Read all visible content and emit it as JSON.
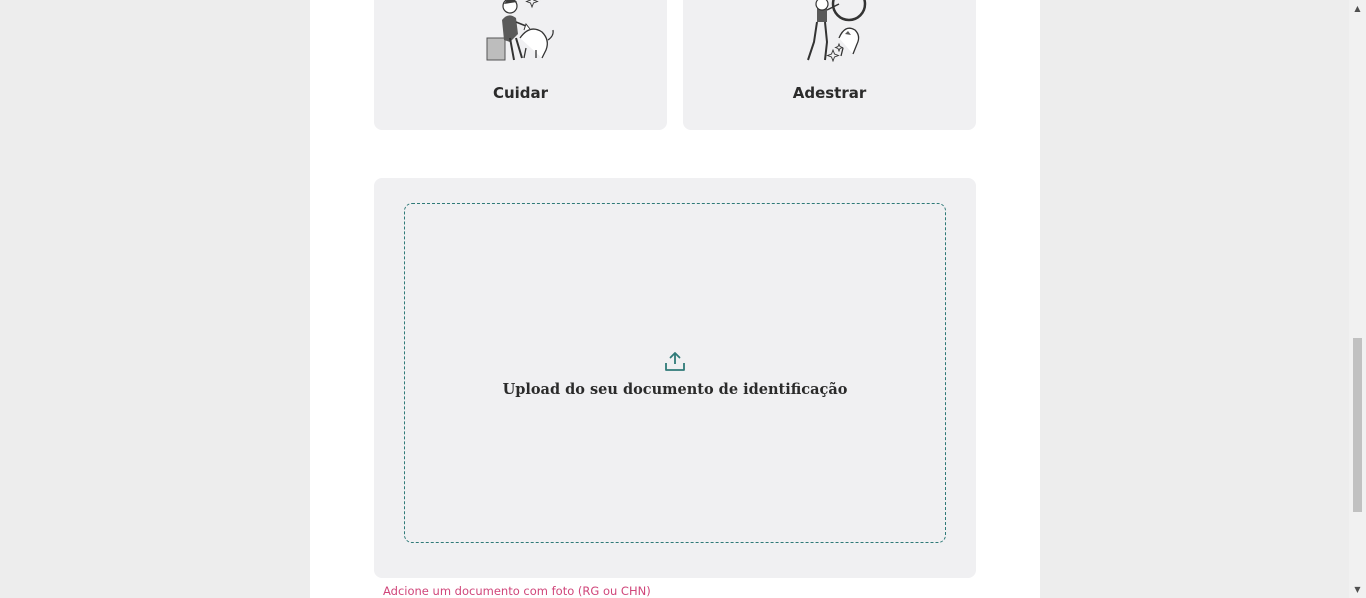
{
  "cards": [
    {
      "label": "Cuidar",
      "icon": "person-petting-dog-illustration"
    },
    {
      "label": "Adestrar",
      "icon": "person-training-dog-illustration"
    }
  ],
  "upload": {
    "label": "Upload do seu documento de identificação",
    "icon": "upload-icon",
    "accent_color": "#2f7a78"
  },
  "hint": {
    "text": "Adcione um documento com foto (RG ou CHN)",
    "color": "#d0467a"
  },
  "scrollbar": {
    "up_glyph": "▲",
    "down_glyph": "▼"
  }
}
